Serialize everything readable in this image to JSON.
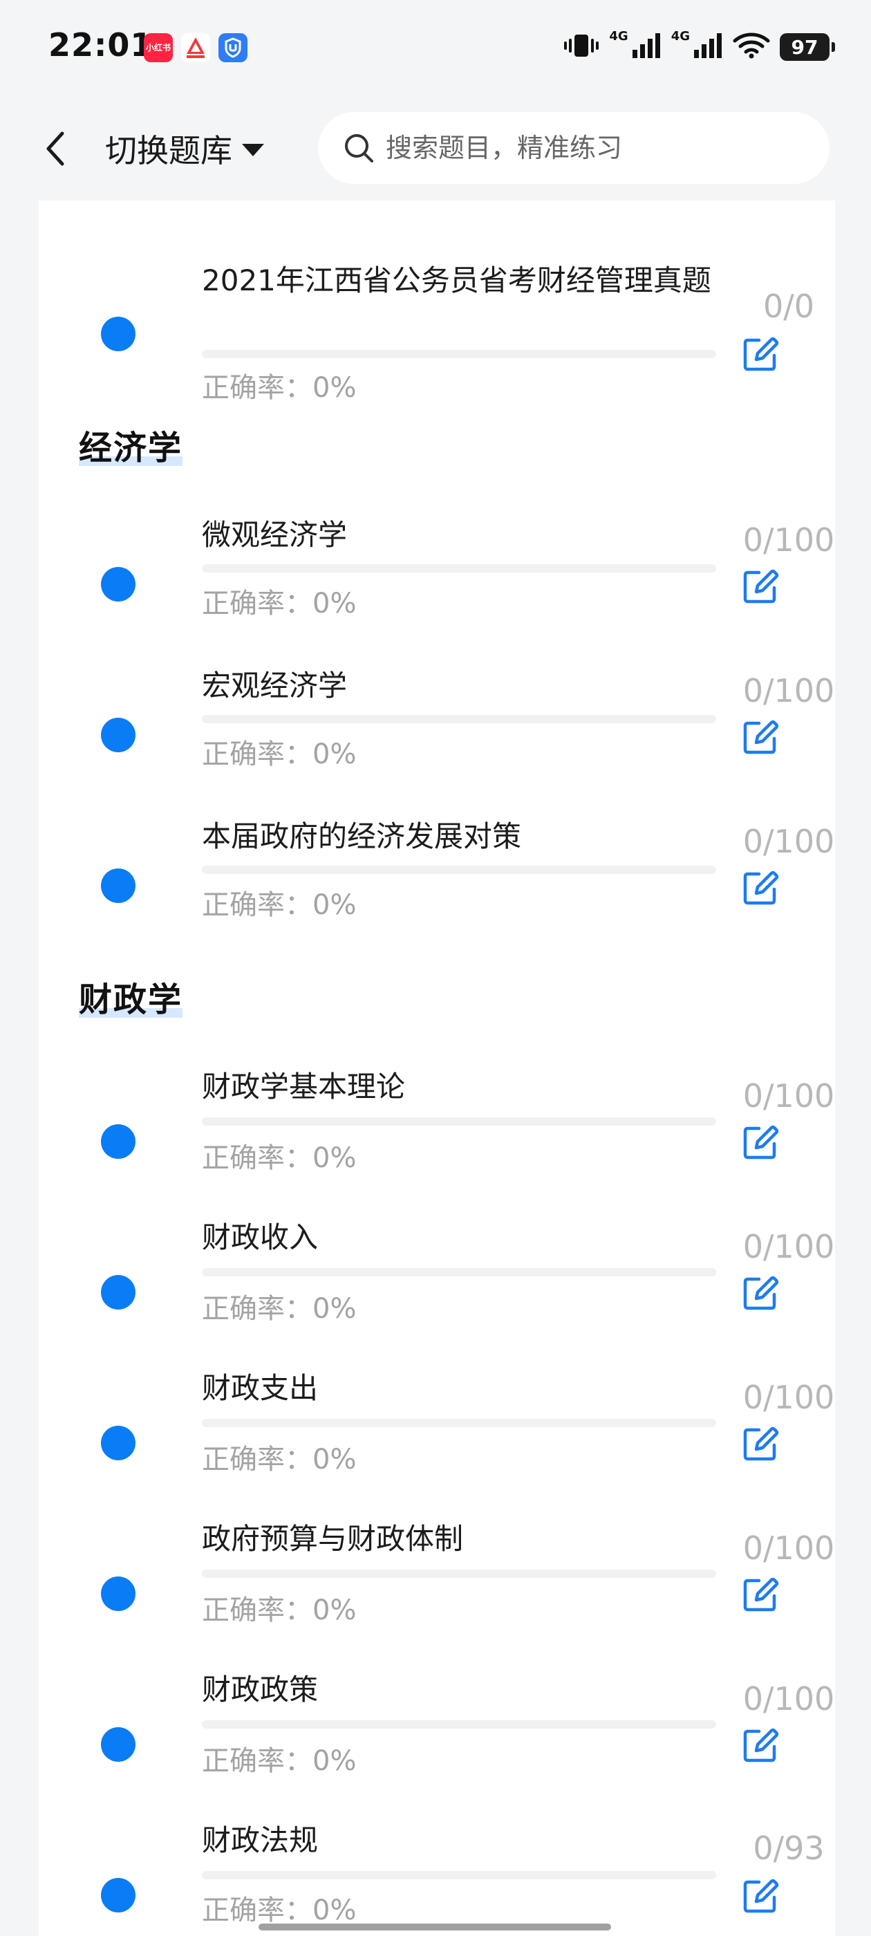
{
  "status_bar": {
    "time": "22:01",
    "apps": [
      {
        "name": "xiaohongshu",
        "label": "小红书",
        "color": "#ff2442"
      },
      {
        "name": "ticket-app",
        "label": "",
        "color": "#ffffff"
      },
      {
        "name": "shield-app",
        "label": "",
        "color": "#2e7cf6"
      }
    ],
    "network": [
      "4G",
      "4G"
    ],
    "battery": "97"
  },
  "header": {
    "switch_label": "切换题库",
    "search_placeholder": "搜索题目，精准练习"
  },
  "sections": [
    {
      "title": "",
      "items": [
        {
          "title": "2021年江西省公务员省考财经管理真题",
          "accuracy": "正确率：0%",
          "count": "0/0",
          "progress": 0
        }
      ]
    },
    {
      "title": "经济学",
      "items": [
        {
          "title": "微观经济学",
          "accuracy": "正确率：0%",
          "count": "0/100",
          "progress": 0
        },
        {
          "title": "宏观经济学",
          "accuracy": "正确率：0%",
          "count": "0/100",
          "progress": 0
        },
        {
          "title": "本届政府的经济发展对策",
          "accuracy": "正确率：0%",
          "count": "0/100",
          "progress": 0
        }
      ]
    },
    {
      "title": "财政学",
      "items": [
        {
          "title": "财政学基本理论",
          "accuracy": "正确率：0%",
          "count": "0/100",
          "progress": 0
        },
        {
          "title": "财政收入",
          "accuracy": "正确率：0%",
          "count": "0/100",
          "progress": 0
        },
        {
          "title": "财政支出",
          "accuracy": "正确率：0%",
          "count": "0/100",
          "progress": 0
        },
        {
          "title": "政府预算与财政体制",
          "accuracy": "正确率：0%",
          "count": "0/100",
          "progress": 0
        },
        {
          "title": "财政政策",
          "accuracy": "正确率：0%",
          "count": "0/100",
          "progress": 0
        },
        {
          "title": "财政法规",
          "accuracy": "正确率：0%",
          "count": "0/93",
          "progress": 0
        }
      ]
    }
  ],
  "colors": {
    "accent": "#0a7cf5",
    "muted_text": "#a3a3a3",
    "count_text": "#b7b7b7",
    "background": "#f4f5f7",
    "section_highlight": "#d6e8ff"
  },
  "icons": {
    "back": "chevron-left-icon",
    "dropdown": "caret-down-icon",
    "search": "search-icon",
    "edit": "edit-icon"
  }
}
